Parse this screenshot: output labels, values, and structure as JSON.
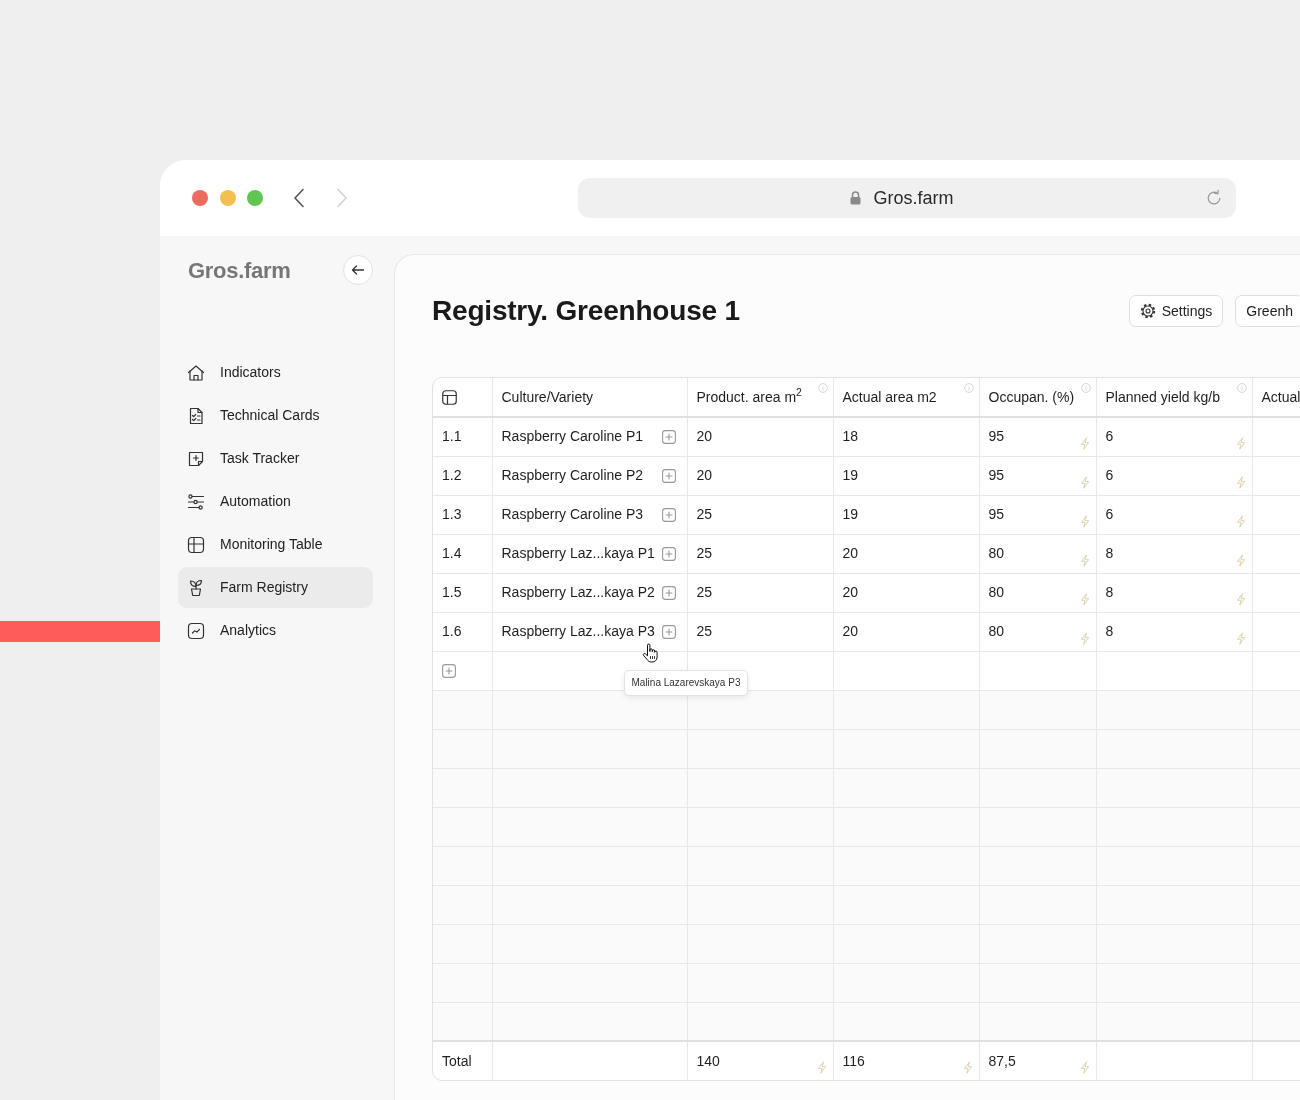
{
  "browser": {
    "back": {
      "disabled": false
    },
    "forward": {
      "disabled": true
    },
    "url": "Gros.farm"
  },
  "sidebar": {
    "logo": "Gros.farm",
    "items": [
      {
        "label": "Indicators",
        "selected": false
      },
      {
        "label": "Technical Cards",
        "selected": false
      },
      {
        "label": "Task Tracker",
        "selected": false
      },
      {
        "label": "Automation",
        "selected": false
      },
      {
        "label": "Monitoring Table",
        "selected": false
      },
      {
        "label": "Farm Registry",
        "selected": true
      },
      {
        "label": "Analytics",
        "selected": false
      }
    ]
  },
  "page": {
    "title": "Registry. Greenhouse 1",
    "buttons": [
      {
        "label": "Settings"
      },
      {
        "label": "Greenh"
      }
    ]
  },
  "table": {
    "columns": [
      {
        "kind": "icon",
        "info": false
      },
      {
        "kind": "text",
        "label": "Culture/Variety",
        "info": false
      },
      {
        "kind": "text",
        "label": "Product. area m$^{2}$",
        "info": true
      },
      {
        "kind": "text",
        "label": "Actual area m2",
        "info": true
      },
      {
        "kind": "text",
        "label": "Occupan. (%)",
        "info": true
      },
      {
        "kind": "text",
        "label": "Planned yield kg/b",
        "info": true
      },
      {
        "kind": "text",
        "label": "Actual",
        "info": false
      }
    ],
    "rows": [
      {
        "number": "1.1",
        "variety": "Raspberry Caroline P1",
        "values": [
          {
            "text": "20",
            "auto": false
          },
          {
            "text": "18",
            "auto": false
          },
          {
            "text": "95",
            "auto": true
          },
          {
            "text": "6",
            "auto": true
          }
        ]
      },
      {
        "number": "1.2",
        "variety": "Raspberry Caroline P2",
        "values": [
          {
            "text": "20",
            "auto": false
          },
          {
            "text": "19",
            "auto": false
          },
          {
            "text": "95",
            "auto": true
          },
          {
            "text": "6",
            "auto": true
          }
        ]
      },
      {
        "number": "1.3",
        "variety": "Raspberry Caroline P3",
        "values": [
          {
            "text": "25",
            "auto": false
          },
          {
            "text": "19",
            "auto": false
          },
          {
            "text": "95",
            "auto": true
          },
          {
            "text": "6",
            "auto": true
          }
        ]
      },
      {
        "number": "1.4",
        "variety": "Raspberry Laz...kaya P1",
        "values": [
          {
            "text": "25",
            "auto": false
          },
          {
            "text": "20",
            "auto": false
          },
          {
            "text": "80",
            "auto": true
          },
          {
            "text": "8",
            "auto": true
          }
        ]
      },
      {
        "number": "1.5",
        "variety": "Raspberry Laz...kaya P2",
        "values": [
          {
            "text": "25",
            "auto": false
          },
          {
            "text": "20",
            "auto": false
          },
          {
            "text": "80",
            "auto": true
          },
          {
            "text": "8",
            "auto": true
          }
        ]
      },
      {
        "number": "1.6",
        "variety": "Raspberry Laz...kaya P3",
        "values": [
          {
            "text": "25",
            "auto": false
          },
          {
            "text": "20",
            "auto": false
          },
          {
            "text": "80",
            "auto": true
          },
          {
            "text": "8",
            "auto": true
          }
        ]
      }
    ],
    "total": {
      "label": "Total",
      "values": [
        {
          "text": "140",
          "auto": true
        },
        {
          "text": "116",
          "auto": true
        },
        {
          "text": "87,5",
          "auto": true
        }
      ]
    },
    "tooltip": {
      "text": "Malina Lazarevskaya P3"
    }
  }
}
